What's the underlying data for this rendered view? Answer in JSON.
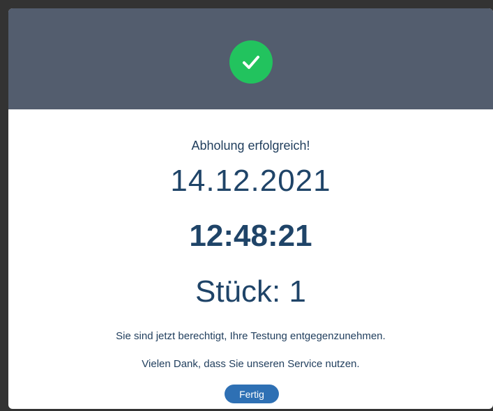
{
  "header": {
    "icon": "checkmark-circle-icon",
    "icon_color": "#22c35e",
    "background": "#535d6e"
  },
  "result": {
    "title": "Abholung erfolgreich!",
    "date": "14.12.2021",
    "time": "12:48:21",
    "count": "Stück: 1",
    "message_eligibility": "Sie sind jetzt berechtigt, Ihre Testung entgegenzunehmen.",
    "message_thanks": "Vielen Dank, dass Sie unseren Service nutzen."
  },
  "actions": {
    "done_label": "Fertig",
    "button_color": "#2e70b4"
  }
}
